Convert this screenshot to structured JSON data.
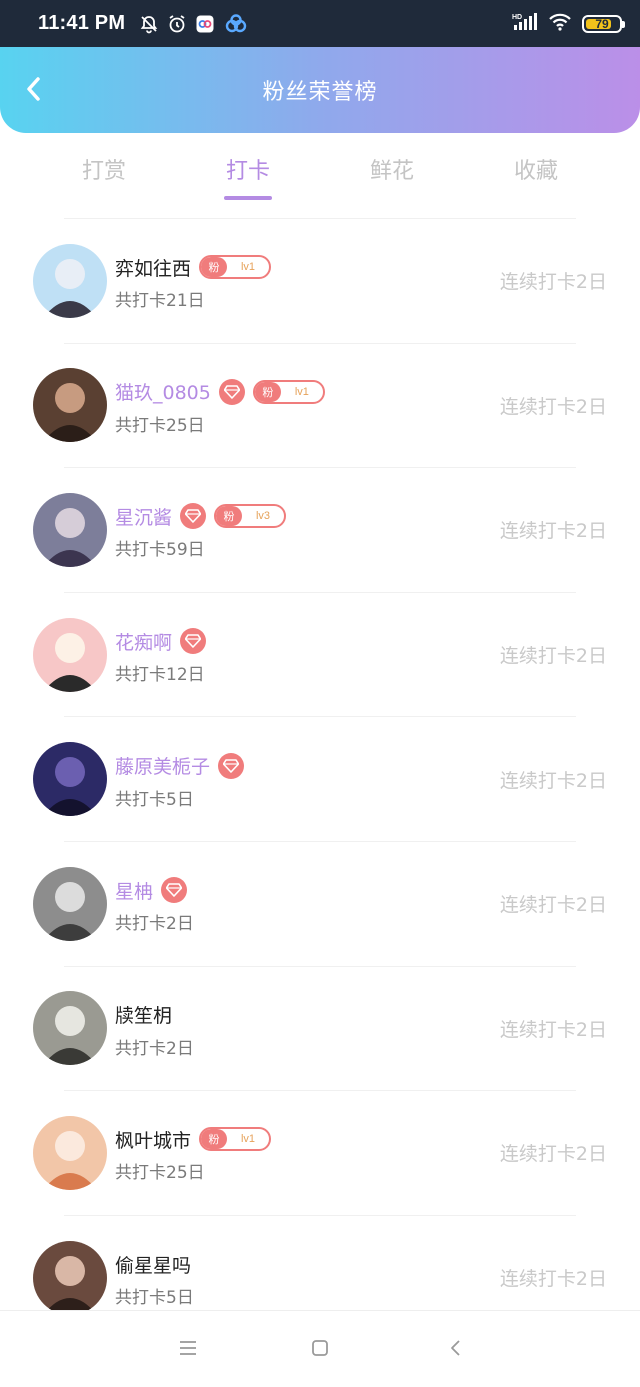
{
  "status_bar": {
    "time": "11:41 PM",
    "battery": "79",
    "battery_percent": 79,
    "icons": [
      "mute-bell-icon",
      "alarm-icon",
      "app-icon",
      "cloud-icon",
      "hd-signal-icon",
      "wifi-icon",
      "battery-icon"
    ]
  },
  "header": {
    "title": "粉丝荣誉榜",
    "back_icon": "chevron-left-icon"
  },
  "tabs": [
    {
      "label": "打赏",
      "active": false
    },
    {
      "label": "打卡",
      "active": true
    },
    {
      "label": "鲜花",
      "active": false
    },
    {
      "label": "收藏",
      "active": false
    }
  ],
  "colors": {
    "accent": "#b48be3",
    "badge": "#f07c7c",
    "header_gradient_start": "#58d3f0",
    "header_gradient_end": "#bb8fe8"
  },
  "fan_badge_prefix": "粉",
  "users": [
    {
      "name": "弈如往西",
      "vip": false,
      "gem": false,
      "fan_level": "lv1",
      "total": "共打卡21日",
      "streak": "连续打卡2日"
    },
    {
      "name": "猫玖_0805",
      "vip": true,
      "gem": true,
      "fan_level": "lv1",
      "total": "共打卡25日",
      "streak": "连续打卡2日"
    },
    {
      "name": "星沉酱",
      "vip": true,
      "gem": true,
      "fan_level": "lv3",
      "total": "共打卡59日",
      "streak": "连续打卡2日"
    },
    {
      "name": "花痴啊",
      "vip": true,
      "gem": true,
      "fan_level": null,
      "total": "共打卡12日",
      "streak": "连续打卡2日"
    },
    {
      "name": "藤原美栀子",
      "vip": true,
      "gem": true,
      "fan_level": null,
      "total": "共打卡5日",
      "streak": "连续打卡2日"
    },
    {
      "name": "星柟",
      "vip": true,
      "gem": true,
      "fan_level": null,
      "total": "共打卡2日",
      "streak": "连续打卡2日"
    },
    {
      "name": "牍笙枂",
      "vip": false,
      "gem": false,
      "fan_level": null,
      "total": "共打卡2日",
      "streak": "连续打卡2日"
    },
    {
      "name": "枫叶城市",
      "vip": false,
      "gem": false,
      "fan_level": "lv1",
      "total": "共打卡25日",
      "streak": "连续打卡2日"
    },
    {
      "name": "偷星星吗",
      "vip": false,
      "gem": false,
      "fan_level": null,
      "total": "共打卡5日",
      "streak": "连续打卡2日"
    }
  ],
  "bottom_nav": [
    "menu-icon",
    "home-square-icon",
    "back-triangle-icon"
  ]
}
